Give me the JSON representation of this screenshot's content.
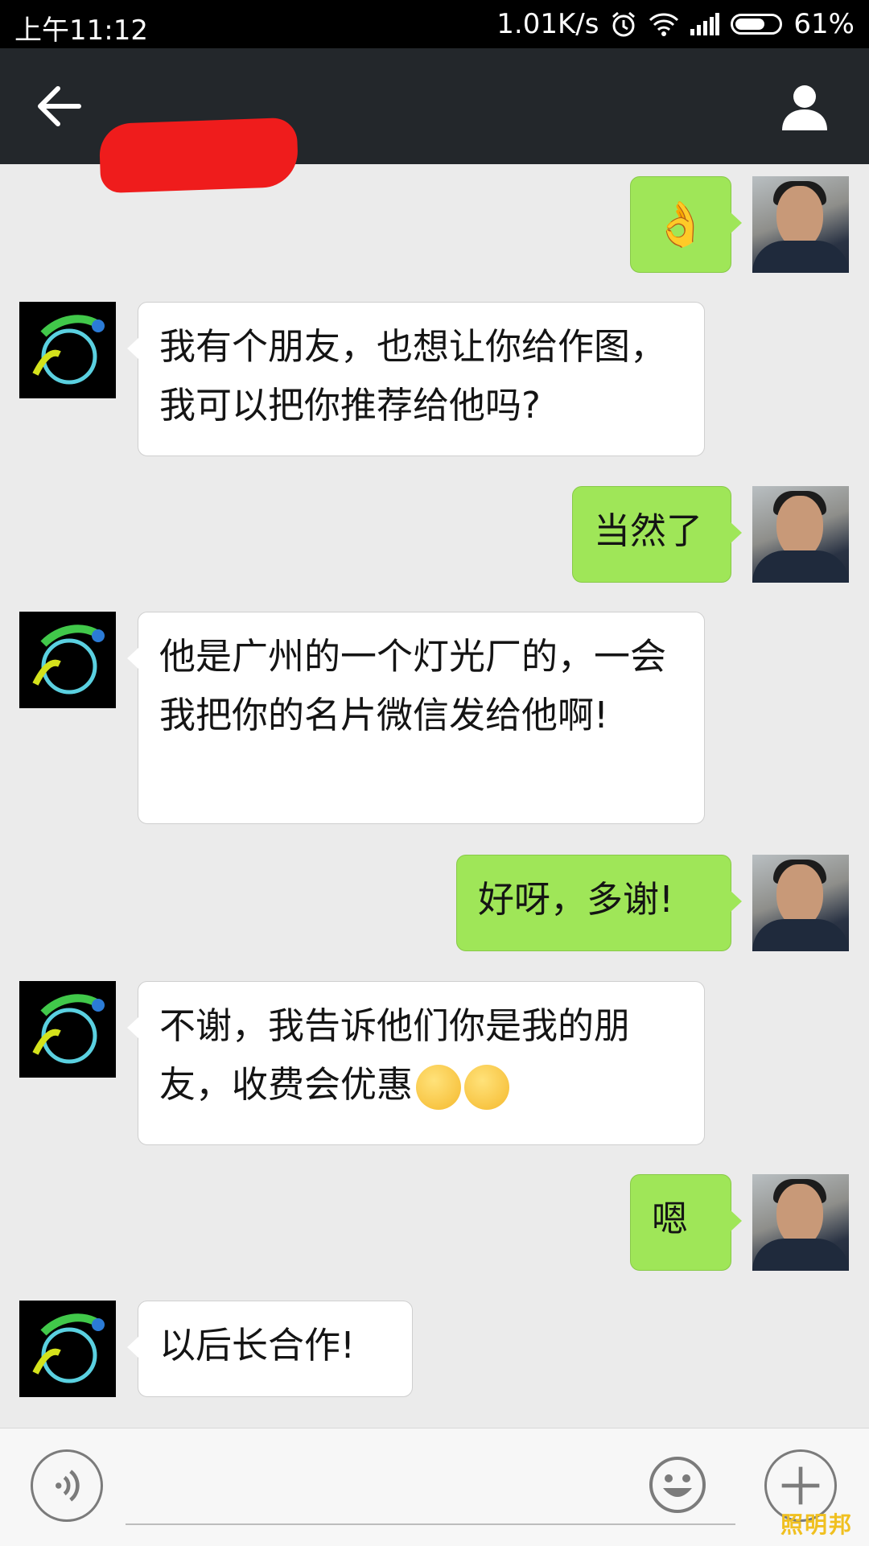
{
  "status_bar": {
    "time": "上午11:12",
    "network_speed": "1.01K/s",
    "battery": "61%"
  },
  "header": {
    "back_icon": "arrow-left-icon",
    "profile_icon": "person-icon"
  },
  "messages": [
    {
      "sender": "me",
      "text": "👌"
    },
    {
      "sender": "other",
      "text": "我有个朋友，也想让你给作图，我可以把你推荐给他吗?"
    },
    {
      "sender": "me",
      "text": "当然了"
    },
    {
      "sender": "other",
      "text": "他是广州的一个灯光厂的，一会我把你的名片微信发给他啊!"
    },
    {
      "sender": "me",
      "text": "好呀，多谢!"
    },
    {
      "sender": "other",
      "text": "不谢，我告诉他们你是我的朋友，收费会优惠"
    },
    {
      "sender": "me",
      "text": "嗯"
    },
    {
      "sender": "other",
      "text": "以后长合作!"
    }
  ],
  "input_bar": {
    "voice_icon": "voice-icon",
    "emoji_icon": "smiley-icon",
    "plus_icon": "plus-icon"
  },
  "watermark": "照明邦"
}
